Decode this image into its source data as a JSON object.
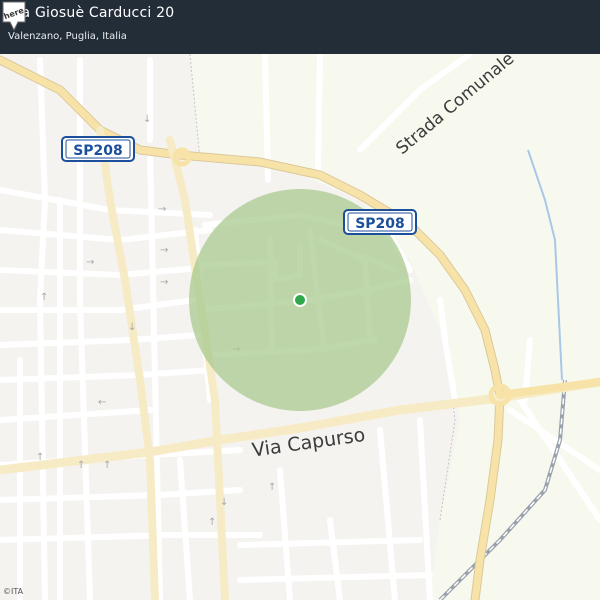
{
  "header": {
    "title": "Via Giosuè Carducci 20",
    "subtitle": "Valenzano, Puglia, Italia"
  },
  "roads": {
    "sp208_label": "SP208",
    "capurso_label": "Via  Capurso",
    "strada_label": "Strada Comunale  Og"
  },
  "marker": {
    "type": "location-dot",
    "color": "#2ea84a",
    "accuracy_color": "#a8c98f"
  },
  "logo_text": "here",
  "attribution": "©ITA",
  "colors": {
    "header_bg": "#232d38",
    "land": "#f5f3f0",
    "countryside": "#f7f9ef",
    "major_road": "#f7e3a8",
    "minor_road": "#ffffff",
    "rail": "#9aa3ad",
    "water": "#a9c7e6"
  }
}
